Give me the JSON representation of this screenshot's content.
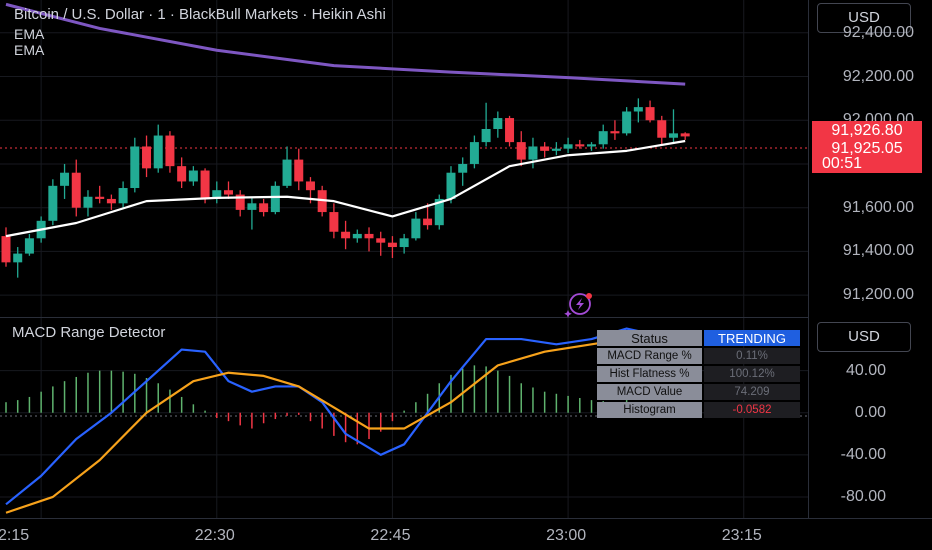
{
  "header": {
    "title": "Bitcoin / U.S. Dollar · 1 · BlackBull Markets · Heikin Ashi",
    "ema_label_1": "EMA",
    "ema_label_2": "EMA",
    "currency": "USD"
  },
  "price_axis": {
    "ticks": [
      "92,400.00",
      "92,200.00",
      "92,000.00",
      "91,800.00",
      "91,600.00",
      "91,400.00",
      "91,200.00"
    ],
    "tag_high": "91,926.80",
    "tag_last": "91,925.05",
    "tag_countdown": "00:51"
  },
  "indicator": {
    "title": "MACD Range Detector",
    "currency": "USD",
    "axis_ticks": [
      "40.00",
      "0.00",
      "-40.00",
      "-80.00"
    ],
    "table": {
      "status_label": "Status",
      "status_value": "TRENDING",
      "rows": [
        {
          "label": "MACD Range %",
          "value": "0.11%"
        },
        {
          "label": "Hist Flatness %",
          "value": "100.12%"
        },
        {
          "label": "MACD Value",
          "value": "74.209"
        },
        {
          "label": "Histogram",
          "value": "-0.0582"
        }
      ]
    }
  },
  "time_axis": {
    "labels": [
      "2:15",
      "22:30",
      "22:45",
      "23:00",
      "23:15"
    ]
  },
  "colors": {
    "up": "#22ab94",
    "down": "#f23645",
    "ema_fast": "#ffffff",
    "ema_slow": "#7e57c2",
    "macd": "#2962ff",
    "signal": "#f7a21b",
    "hist_pos": "#5fb36e",
    "hist_neg": "#f23645"
  },
  "chart_data": [
    {
      "type": "candlestick",
      "title": "Bitcoin / U.S. Dollar · 1 · BlackBull Markets · Heikin Ashi",
      "ylim": [
        91100,
        92550
      ],
      "x_range": [
        "22:12",
        "23:21"
      ],
      "candles": [
        {
          "t": "22:12",
          "o": 91470,
          "h": 91510,
          "l": 91330,
          "c": 91350
        },
        {
          "t": "22:13",
          "o": 91350,
          "h": 91420,
          "l": 91280,
          "c": 91390
        },
        {
          "t": "22:14",
          "o": 91390,
          "h": 91480,
          "l": 91380,
          "c": 91460
        },
        {
          "t": "22:15",
          "o": 91460,
          "h": 91560,
          "l": 91440,
          "c": 91540
        },
        {
          "t": "22:16",
          "o": 91540,
          "h": 91730,
          "l": 91520,
          "c": 91700
        },
        {
          "t": "22:17",
          "o": 91700,
          "h": 91800,
          "l": 91640,
          "c": 91760
        },
        {
          "t": "22:18",
          "o": 91760,
          "h": 91820,
          "l": 91560,
          "c": 91600
        },
        {
          "t": "22:19",
          "o": 91600,
          "h": 91680,
          "l": 91560,
          "c": 91650
        },
        {
          "t": "22:20",
          "o": 91650,
          "h": 91700,
          "l": 91620,
          "c": 91640
        },
        {
          "t": "22:21",
          "o": 91640,
          "h": 91660,
          "l": 91590,
          "c": 91620
        },
        {
          "t": "22:22",
          "o": 91620,
          "h": 91720,
          "l": 91600,
          "c": 91690
        },
        {
          "t": "22:23",
          "o": 91690,
          "h": 91920,
          "l": 91670,
          "c": 91880
        },
        {
          "t": "22:24",
          "o": 91880,
          "h": 91930,
          "l": 91740,
          "c": 91780
        },
        {
          "t": "22:25",
          "o": 91780,
          "h": 91980,
          "l": 91760,
          "c": 91930
        },
        {
          "t": "22:26",
          "o": 91930,
          "h": 91950,
          "l": 91760,
          "c": 91790
        },
        {
          "t": "22:27",
          "o": 91790,
          "h": 91830,
          "l": 91690,
          "c": 91720
        },
        {
          "t": "22:28",
          "o": 91720,
          "h": 91790,
          "l": 91700,
          "c": 91770
        },
        {
          "t": "22:29",
          "o": 91770,
          "h": 91780,
          "l": 91620,
          "c": 91640
        },
        {
          "t": "22:30",
          "o": 91640,
          "h": 91720,
          "l": 91620,
          "c": 91680
        },
        {
          "t": "22:31",
          "o": 91680,
          "h": 91720,
          "l": 91640,
          "c": 91660
        },
        {
          "t": "22:32",
          "o": 91660,
          "h": 91680,
          "l": 91560,
          "c": 91590
        },
        {
          "t": "22:33",
          "o": 91590,
          "h": 91650,
          "l": 91500,
          "c": 91620
        },
        {
          "t": "22:34",
          "o": 91620,
          "h": 91640,
          "l": 91560,
          "c": 91580
        },
        {
          "t": "22:35",
          "o": 91580,
          "h": 91720,
          "l": 91570,
          "c": 91700
        },
        {
          "t": "22:36",
          "o": 91700,
          "h": 91880,
          "l": 91690,
          "c": 91820
        },
        {
          "t": "22:37",
          "o": 91820,
          "h": 91870,
          "l": 91680,
          "c": 91720
        },
        {
          "t": "22:38",
          "o": 91720,
          "h": 91740,
          "l": 91620,
          "c": 91680
        },
        {
          "t": "22:39",
          "o": 91680,
          "h": 91700,
          "l": 91560,
          "c": 91580
        },
        {
          "t": "22:40",
          "o": 91580,
          "h": 91620,
          "l": 91460,
          "c": 91490
        },
        {
          "t": "22:41",
          "o": 91490,
          "h": 91540,
          "l": 91410,
          "c": 91460
        },
        {
          "t": "22:42",
          "o": 91460,
          "h": 91500,
          "l": 91440,
          "c": 91480
        },
        {
          "t": "22:43",
          "o": 91480,
          "h": 91510,
          "l": 91400,
          "c": 91460
        },
        {
          "t": "22:44",
          "o": 91460,
          "h": 91490,
          "l": 91380,
          "c": 91440
        },
        {
          "t": "22:45",
          "o": 91440,
          "h": 91470,
          "l": 91370,
          "c": 91420
        },
        {
          "t": "22:46",
          "o": 91420,
          "h": 91480,
          "l": 91390,
          "c": 91460
        },
        {
          "t": "22:47",
          "o": 91460,
          "h": 91580,
          "l": 91450,
          "c": 91550
        },
        {
          "t": "22:48",
          "o": 91550,
          "h": 91620,
          "l": 91500,
          "c": 91520
        },
        {
          "t": "22:49",
          "o": 91520,
          "h": 91660,
          "l": 91500,
          "c": 91640
        },
        {
          "t": "22:50",
          "o": 91640,
          "h": 91790,
          "l": 91620,
          "c": 91760
        },
        {
          "t": "22:51",
          "o": 91760,
          "h": 91830,
          "l": 91700,
          "c": 91800
        },
        {
          "t": "22:52",
          "o": 91800,
          "h": 91930,
          "l": 91780,
          "c": 91900
        },
        {
          "t": "22:53",
          "o": 91900,
          "h": 92080,
          "l": 91880,
          "c": 91960
        },
        {
          "t": "22:54",
          "o": 91960,
          "h": 92040,
          "l": 91920,
          "c": 92010
        },
        {
          "t": "22:55",
          "o": 92010,
          "h": 92020,
          "l": 91880,
          "c": 91900
        },
        {
          "t": "22:56",
          "o": 91900,
          "h": 91950,
          "l": 91790,
          "c": 91820
        },
        {
          "t": "22:57",
          "o": 91820,
          "h": 91920,
          "l": 91780,
          "c": 91880
        },
        {
          "t": "22:58",
          "o": 91880,
          "h": 91900,
          "l": 91830,
          "c": 91860
        },
        {
          "t": "22:59",
          "o": 91860,
          "h": 91900,
          "l": 91840,
          "c": 91870
        },
        {
          "t": "23:00",
          "o": 91870,
          "h": 91920,
          "l": 91850,
          "c": 91890
        },
        {
          "t": "23:01",
          "o": 91890,
          "h": 91910,
          "l": 91870,
          "c": 91880
        },
        {
          "t": "23:02",
          "o": 91880,
          "h": 91900,
          "l": 91860,
          "c": 91890
        },
        {
          "t": "23:03",
          "o": 91890,
          "h": 91980,
          "l": 91870,
          "c": 91950
        },
        {
          "t": "23:04",
          "o": 91950,
          "h": 92000,
          "l": 91910,
          "c": 91940
        },
        {
          "t": "23:05",
          "o": 91940,
          "h": 92060,
          "l": 91930,
          "c": 92040
        },
        {
          "t": "23:06",
          "o": 92040,
          "h": 92100,
          "l": 91990,
          "c": 92060
        },
        {
          "t": "23:07",
          "o": 92060,
          "h": 92090,
          "l": 91990,
          "c": 92000
        },
        {
          "t": "23:08",
          "o": 92000,
          "h": 92020,
          "l": 91890,
          "c": 91920
        },
        {
          "t": "23:09",
          "o": 91920,
          "h": 92050,
          "l": 91900,
          "c": 91940
        },
        {
          "t": "23:10",
          "o": 91940,
          "h": 91945,
          "l": 91910,
          "c": 91926
        }
      ],
      "series": [
        {
          "name": "EMA",
          "values": [
            {
              "t": "22:12",
              "v": 91470
            },
            {
              "t": "22:18",
              "v": 91530
            },
            {
              "t": "22:24",
              "v": 91630
            },
            {
              "t": "22:30",
              "v": 91645
            },
            {
              "t": "22:36",
              "v": 91650
            },
            {
              "t": "22:40",
              "v": 91630
            },
            {
              "t": "22:45",
              "v": 91560
            },
            {
              "t": "22:50",
              "v": 91640
            },
            {
              "t": "22:55",
              "v": 91790
            },
            {
              "t": "23:00",
              "v": 91840
            },
            {
              "t": "23:05",
              "v": 91860
            },
            {
              "t": "23:10",
              "v": 91905
            }
          ]
        },
        {
          "name": "EMA",
          "values": [
            {
              "t": "22:12",
              "v": 92530
            },
            {
              "t": "22:20",
              "v": 92420
            },
            {
              "t": "22:30",
              "v": 92320
            },
            {
              "t": "22:40",
              "v": 92250
            },
            {
              "t": "22:50",
              "v": 92220
            },
            {
              "t": "23:00",
              "v": 92195
            },
            {
              "t": "23:10",
              "v": 92165
            }
          ]
        }
      ]
    },
    {
      "type": "line",
      "title": "MACD Range Detector",
      "ylim": [
        -100,
        90
      ],
      "x_range": [
        "22:12",
        "23:21"
      ],
      "series": [
        {
          "values": [
            {
              "t": "22:12",
              "v": -87
            },
            {
              "t": "22:15",
              "v": -60
            },
            {
              "t": "22:18",
              "v": -25
            },
            {
              "t": "22:21",
              "v": 0
            },
            {
              "t": "22:24",
              "v": 30
            },
            {
              "t": "22:27",
              "v": 60
            },
            {
              "t": "22:29",
              "v": 58
            },
            {
              "t": "22:31",
              "v": 30
            },
            {
              "t": "22:33",
              "v": 20
            },
            {
              "t": "22:35",
              "v": 25
            },
            {
              "t": "22:37",
              "v": 25
            },
            {
              "t": "22:39",
              "v": 10
            },
            {
              "t": "22:41",
              "v": -20
            },
            {
              "t": "22:44",
              "v": -40
            },
            {
              "t": "22:46",
              "v": -30
            },
            {
              "t": "22:48",
              "v": 0
            },
            {
              "t": "22:50",
              "v": 30
            },
            {
              "t": "22:53",
              "v": 70
            },
            {
              "t": "22:56",
              "v": 70
            },
            {
              "t": "22:59",
              "v": 65
            },
            {
              "t": "23:02",
              "v": 70
            },
            {
              "t": "23:05",
              "v": 80
            },
            {
              "t": "23:07",
              "v": 75
            },
            {
              "t": "23:10",
              "v": 74.209
            }
          ]
        },
        {
          "values": [
            {
              "t": "22:12",
              "v": -95
            },
            {
              "t": "22:16",
              "v": -80
            },
            {
              "t": "22:20",
              "v": -45
            },
            {
              "t": "22:24",
              "v": 0
            },
            {
              "t": "22:28",
              "v": 30
            },
            {
              "t": "22:31",
              "v": 38
            },
            {
              "t": "22:34",
              "v": 35
            },
            {
              "t": "22:37",
              "v": 25
            },
            {
              "t": "22:40",
              "v": 5
            },
            {
              "t": "22:43",
              "v": -15
            },
            {
              "t": "22:46",
              "v": -15
            },
            {
              "t": "22:50",
              "v": 10
            },
            {
              "t": "22:54",
              "v": 45
            },
            {
              "t": "22:58",
              "v": 58
            },
            {
              "t": "23:02",
              "v": 65
            },
            {
              "t": "23:06",
              "v": 72
            },
            {
              "t": "23:10",
              "v": 74.27
            }
          ]
        }
      ],
      "histogram": [
        {
          "t": "22:12",
          "v": 10
        },
        {
          "t": "22:13",
          "v": 12
        },
        {
          "t": "22:14",
          "v": 15
        },
        {
          "t": "22:15",
          "v": 20
        },
        {
          "t": "22:16",
          "v": 25
        },
        {
          "t": "22:17",
          "v": 30
        },
        {
          "t": "22:18",
          "v": 34
        },
        {
          "t": "22:19",
          "v": 38
        },
        {
          "t": "22:20",
          "v": 40
        },
        {
          "t": "22:21",
          "v": 40
        },
        {
          "t": "22:22",
          "v": 39
        },
        {
          "t": "22:23",
          "v": 37
        },
        {
          "t": "22:24",
          "v": 33
        },
        {
          "t": "22:25",
          "v": 28
        },
        {
          "t": "22:26",
          "v": 22
        },
        {
          "t": "22:27",
          "v": 15
        },
        {
          "t": "22:28",
          "v": 8
        },
        {
          "t": "22:29",
          "v": 2
        },
        {
          "t": "22:30",
          "v": -5
        },
        {
          "t": "22:31",
          "v": -8
        },
        {
          "t": "22:32",
          "v": -12
        },
        {
          "t": "22:33",
          "v": -15
        },
        {
          "t": "22:34",
          "v": -10
        },
        {
          "t": "22:35",
          "v": -6
        },
        {
          "t": "22:36",
          "v": -3
        },
        {
          "t": "22:37",
          "v": -2
        },
        {
          "t": "22:38",
          "v": -8
        },
        {
          "t": "22:39",
          "v": -15
        },
        {
          "t": "22:40",
          "v": -22
        },
        {
          "t": "22:41",
          "v": -28
        },
        {
          "t": "22:42",
          "v": -30
        },
        {
          "t": "22:43",
          "v": -25
        },
        {
          "t": "22:44",
          "v": -18
        },
        {
          "t": "22:45",
          "v": -8
        },
        {
          "t": "22:46",
          "v": 2
        },
        {
          "t": "22:47",
          "v": 10
        },
        {
          "t": "22:48",
          "v": 18
        },
        {
          "t": "22:49",
          "v": 28
        },
        {
          "t": "22:50",
          "v": 36
        },
        {
          "t": "22:51",
          "v": 42
        },
        {
          "t": "22:52",
          "v": 45
        },
        {
          "t": "22:53",
          "v": 44
        },
        {
          "t": "22:54",
          "v": 40
        },
        {
          "t": "22:55",
          "v": 35
        },
        {
          "t": "22:56",
          "v": 28
        },
        {
          "t": "22:57",
          "v": 24
        },
        {
          "t": "22:58",
          "v": 20
        },
        {
          "t": "22:59",
          "v": 18
        },
        {
          "t": "23:00",
          "v": 16
        },
        {
          "t": "23:01",
          "v": 14
        },
        {
          "t": "23:02",
          "v": 12
        },
        {
          "t": "23:03",
          "v": 11
        },
        {
          "t": "23:04",
          "v": 10
        },
        {
          "t": "23:05",
          "v": 12
        },
        {
          "t": "23:06",
          "v": 8
        },
        {
          "t": "23:07",
          "v": 5
        },
        {
          "t": "23:08",
          "v": 3
        },
        {
          "t": "23:09",
          "v": 1
        },
        {
          "t": "23:10",
          "v": -0.0582
        }
      ]
    }
  ]
}
